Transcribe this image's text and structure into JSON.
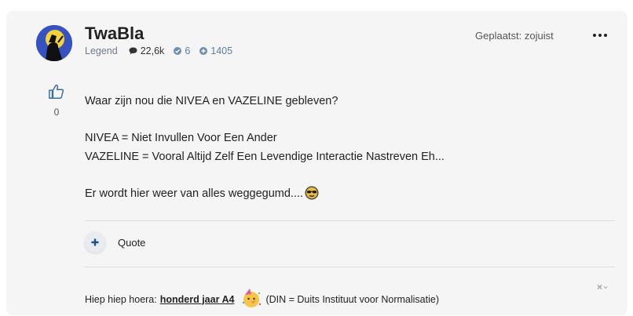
{
  "author": {
    "name": "TwaBla",
    "rank": "Legend",
    "messages": "22,6k",
    "reactions": "6",
    "points": "1405"
  },
  "post": {
    "posted": "Geplaatst: zojuist",
    "like_count": "0",
    "lines": [
      "Waar zijn nou die NIVEA en VAZELINE gebleven?",
      "NIVEA = Niet Invullen Voor Een Ander",
      "VAZELINE = Vooral Altijd Zelf Een Levendige Interactie Nastreven Eh...",
      "Er wordt hier weer van alles weggegumd...."
    ]
  },
  "actions": {
    "quote_label": "Quote"
  },
  "signature": {
    "prefix": "Hiep hiep hoera:",
    "link_text": "honderd jaar A4",
    "suffix": "(DIN = Duits Instituut voor Normalisatie)"
  },
  "icons": {
    "like": "thumbs-up-icon",
    "more": "ellipsis-icon",
    "messages": "speech-bubble-icon",
    "reactions": "check-circle-icon",
    "points": "plus-circle-icon",
    "add": "plus-icon",
    "close": "close-icon",
    "emoji_post": "sunglasses-emoji",
    "emoji_sig": "party-face-emoji"
  },
  "colors": {
    "card_bg": "#f5f5f5",
    "stat_blue": "#5c7c9c",
    "avatar_bg": "#3a5fc8"
  }
}
